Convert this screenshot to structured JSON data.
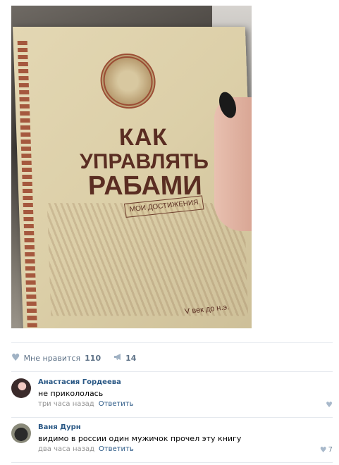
{
  "post": {
    "image_alt": "",
    "book": {
      "title_line1": "КАК",
      "title_line2": "УПРАВЛЯТЬ",
      "title_line3": "РАБАМИ",
      "subtitle": "МОИ ДОСТИЖЕНИЯ",
      "footer": "V век до н.э."
    }
  },
  "actions": {
    "like_label": "Мне нравится",
    "like_count": "110",
    "share_count": "14",
    "like_icon": "heart-icon",
    "share_icon": "megaphone-icon"
  },
  "comments": [
    {
      "author": "Анастасия Гордеева",
      "text": "не прикололась",
      "time": "три часа назад",
      "reply_label": "Ответить",
      "likes": ""
    },
    {
      "author": "Ваня Дурн",
      "text": "видимо в россии один мужичок прочел эту книгу",
      "time": "два часа назад",
      "reply_label": "Ответить",
      "likes": "7"
    }
  ],
  "colors": {
    "link": "#2a5885",
    "meta": "#939393",
    "icon": "#a0b2c4"
  }
}
